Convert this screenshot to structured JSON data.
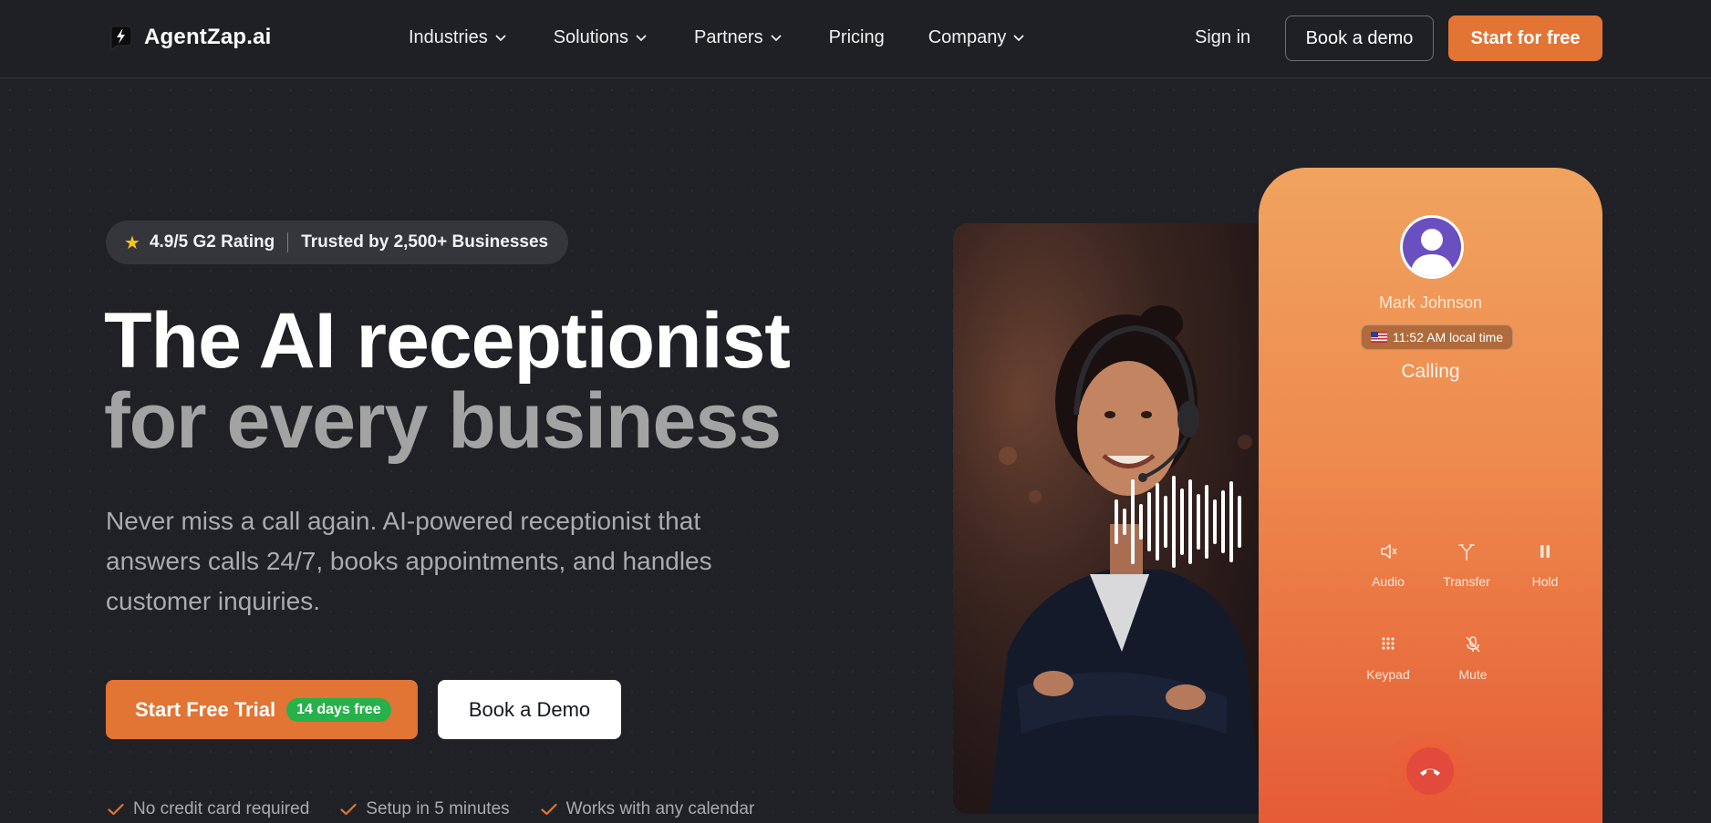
{
  "nav": {
    "logo_text": "AgentZap.ai",
    "menu": [
      {
        "label": "Industries",
        "has_dropdown": true
      },
      {
        "label": "Solutions",
        "has_dropdown": true
      },
      {
        "label": "Partners",
        "has_dropdown": true
      },
      {
        "label": "Pricing",
        "has_dropdown": false
      },
      {
        "label": "Company",
        "has_dropdown": true
      }
    ],
    "sign_in": "Sign in",
    "book_demo": "Book a demo",
    "start_free": "Start for free"
  },
  "hero": {
    "rating": "4.9/5 G2 Rating",
    "trusted": "Trusted by 2,500+ Businesses",
    "title_line1": "The AI receptionist",
    "title_line2": "for every business",
    "subtitle": "Never miss a call again. AI-powered receptionist that answers calls 24/7, books appointments, and handles customer inquiries.",
    "cta_primary": "Start Free Trial",
    "cta_badge": "14 days free",
    "cta_secondary": "Book a Demo",
    "checks": [
      "No credit card required",
      "Setup in 5 minutes",
      "Works with any calendar"
    ]
  },
  "phone": {
    "caller_name": "Mark Johnson",
    "local_time": "11:52 AM local time",
    "status": "Calling",
    "controls": {
      "audio": "Audio",
      "transfer": "Transfer",
      "hold": "Hold",
      "keypad": "Keypad",
      "mute": "Mute"
    }
  },
  "colors": {
    "accent": "#e27434",
    "background": "#1f2126",
    "badge_green": "#27b14b",
    "phone_gradient_top": "#f0a35f",
    "phone_gradient_bottom": "#e55b35"
  },
  "icons": [
    "logo-bolt-icon",
    "chevron-down-icon",
    "star-icon",
    "check-icon",
    "speaker-icon",
    "transfer-icon",
    "pause-icon",
    "keypad-icon",
    "mic-off-icon",
    "phone-hangup-icon",
    "us-flag-icon",
    "user-avatar-icon",
    "sound-wave-icon"
  ]
}
